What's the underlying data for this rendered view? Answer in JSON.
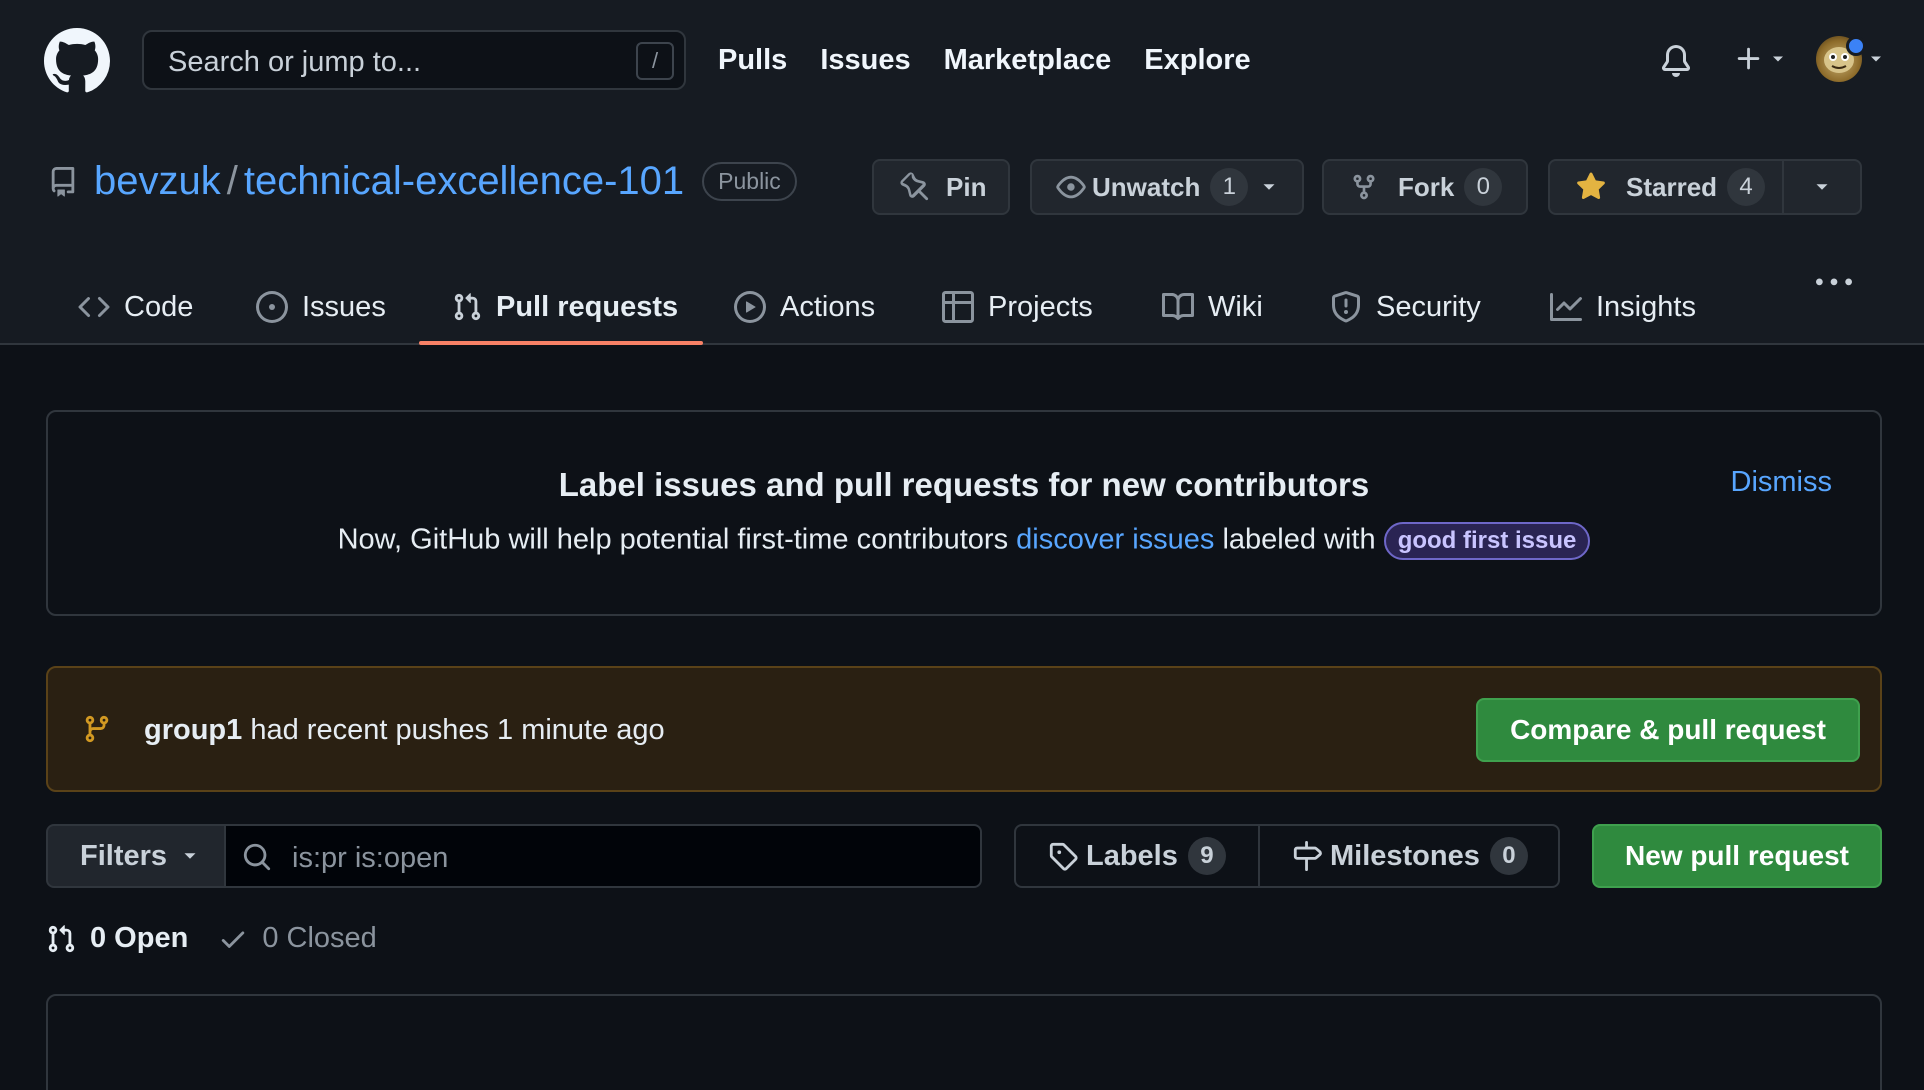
{
  "header": {
    "search_placeholder": "Search or jump to...",
    "search_shortcut": "/",
    "nav": [
      "Pulls",
      "Issues",
      "Marketplace",
      "Explore"
    ]
  },
  "repo": {
    "owner": "bevzuk",
    "separator": "/",
    "name": "technical-excellence-101",
    "visibility": "Public",
    "pin_label": "Pin",
    "watch_label": "Unwatch",
    "watch_count": "1",
    "fork_label": "Fork",
    "fork_count": "0",
    "star_label": "Starred",
    "star_count": "4"
  },
  "tabs": [
    {
      "label": "Code",
      "icon": "code-icon"
    },
    {
      "label": "Issues",
      "icon": "issue-opened-icon"
    },
    {
      "label": "Pull requests",
      "icon": "git-pull-request-icon",
      "active": true
    },
    {
      "label": "Actions",
      "icon": "play-icon"
    },
    {
      "label": "Projects",
      "icon": "table-icon"
    },
    {
      "label": "Wiki",
      "icon": "book-icon"
    },
    {
      "label": "Security",
      "icon": "shield-icon"
    },
    {
      "label": "Insights",
      "icon": "graph-icon"
    }
  ],
  "contributor_banner": {
    "title": "Label issues and pull requests for new contributors",
    "text_before": "Now, GitHub will help potential first-time contributors ",
    "link": "discover issues",
    "text_after": " labeled with ",
    "label": "good first issue",
    "dismiss": "Dismiss"
  },
  "recent_pushes": {
    "branch": "group1",
    "text": " had recent pushes 1 minute ago",
    "button": "Compare & pull request"
  },
  "filters": {
    "filters_label": "Filters",
    "query": "is:pr is:open",
    "labels_label": "Labels",
    "labels_count": "9",
    "milestones_label": "Milestones",
    "milestones_count": "0",
    "new_pr_button": "New pull request"
  },
  "states": {
    "open": "0 Open",
    "closed": "0 Closed"
  },
  "colors": {
    "accent_link": "#58a6ff",
    "active_tab_underline": "#f78166",
    "primary_button": "#2f8a3e"
  }
}
